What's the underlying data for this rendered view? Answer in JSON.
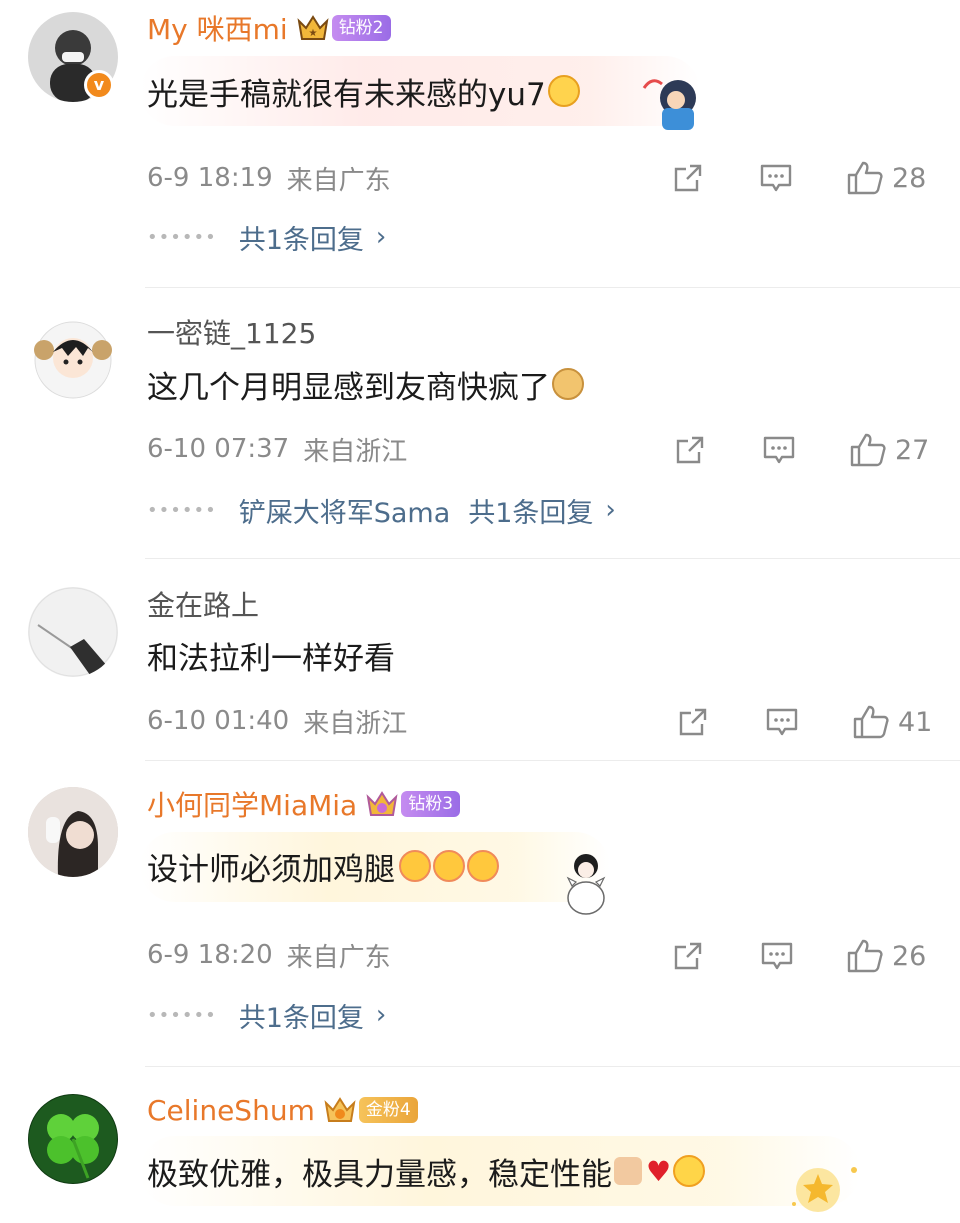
{
  "comments": [
    {
      "user": "My 咪西mi",
      "fan_badge": "钻粉2",
      "text": "光是手稿就很有未来感的yu7",
      "time": "6-9 18:19",
      "location": "来自广东",
      "likes": "28",
      "reply_prefix": "",
      "reply_link": "共1条回复"
    },
    {
      "user": "一密链_1125",
      "text": "这几个月明显感到友商快疯了",
      "time": "6-10 07:37",
      "location": "来自浙江",
      "likes": "27",
      "reply_prefix": "铲屎大将军Sama",
      "reply_link": "共1条回复"
    },
    {
      "user": "金在路上",
      "text": "和法拉利一样好看",
      "time": "6-10 01:40",
      "location": "来自浙江",
      "likes": "41"
    },
    {
      "user": "小何同学MiaMia",
      "fan_badge": "钻粉3",
      "text": "设计师必须加鸡腿",
      "time": "6-9 18:20",
      "location": "来自广东",
      "likes": "26",
      "reply_link": "共1条回复"
    },
    {
      "user": "CelineShum",
      "fan_badge": "金粉4",
      "text": "极致优雅，极具力量感，稳定性能"
    }
  ],
  "colors": {
    "username_highlight": "#e8782a",
    "reply_link": "#4d6d8c",
    "meta_gray": "#8a8a8a",
    "badge_purple": "#a775ea",
    "badge_gold": "#eaa53a"
  },
  "icons": [
    "verified-badge-icon",
    "crown-icon",
    "grin-emoji-icon",
    "doge-emoji-icon",
    "chick-emoji-icon",
    "thumbs-up-emoji-icon",
    "heart-emoji-icon",
    "sun-emoji-icon",
    "repost-icon",
    "comment-icon",
    "like-icon",
    "chevron-right-icon"
  ]
}
